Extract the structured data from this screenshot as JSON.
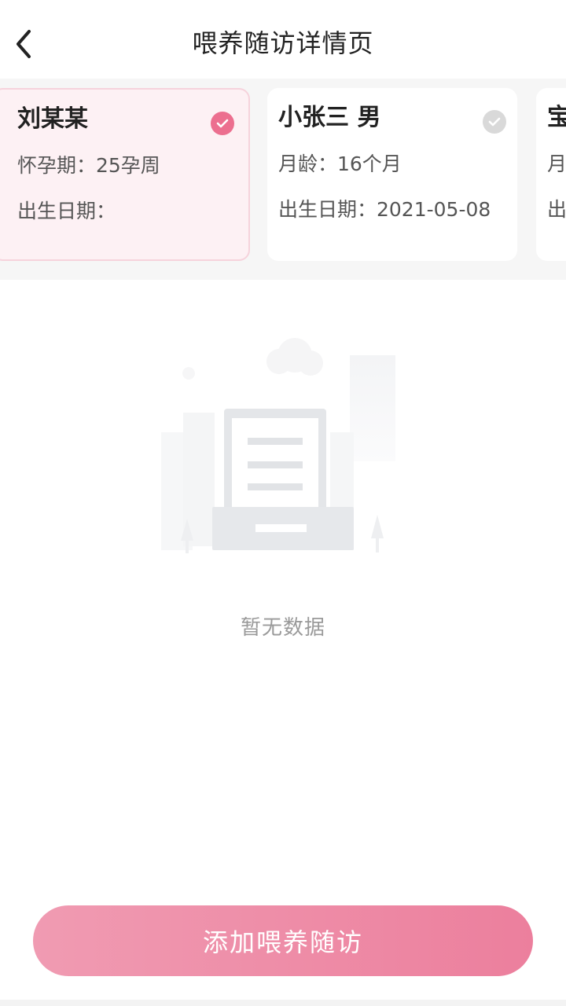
{
  "header": {
    "title": "喂养随访详情页",
    "back_icon": "chevron-left-icon"
  },
  "cards": [
    {
      "name": "刘某某",
      "line1": "怀孕期：25孕周",
      "line2": "出生日期：",
      "selected": true
    },
    {
      "name": "小张三 男",
      "line1": "月龄：16个月",
      "line2": "出生日期：2021-05-08",
      "selected": false
    },
    {
      "name": "宝",
      "line1": "月",
      "line2": "出",
      "selected": false
    }
  ],
  "empty": {
    "text": "暂无数据",
    "icon": "empty-document-icon"
  },
  "footer": {
    "add_label": "添加喂养随访"
  },
  "colors": {
    "accent": "#ec6f8f",
    "selected_bg": "#fdf1f4",
    "button_start": "#f09bb2",
    "button_end": "#ec7f9d"
  }
}
